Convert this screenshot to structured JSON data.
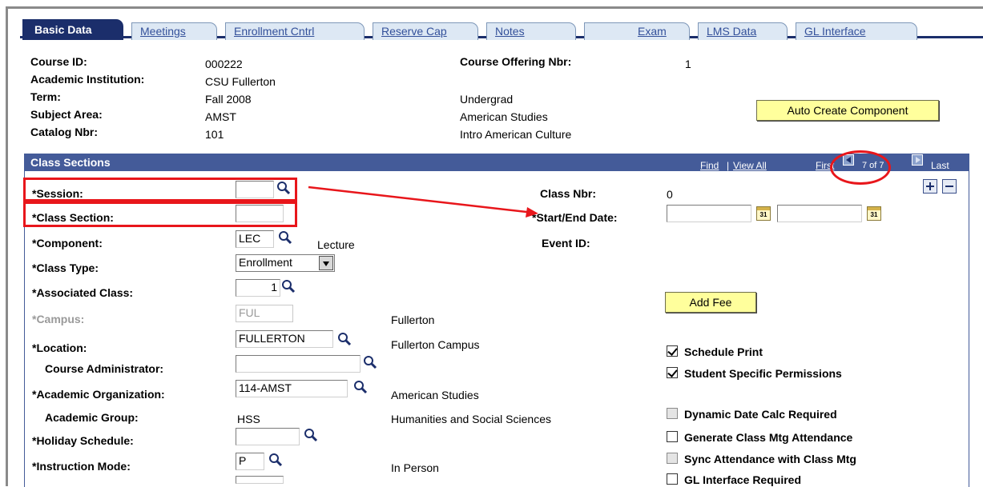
{
  "tabs": [
    {
      "label": "Basic Data",
      "active": true
    },
    {
      "label": "Meetings"
    },
    {
      "label": "Enrollment Cntrl"
    },
    {
      "label": "Reserve Cap"
    },
    {
      "label": "Notes"
    },
    {
      "label": "Exam"
    },
    {
      "label": "LMS Data"
    },
    {
      "label": "GL Interface"
    }
  ],
  "header": {
    "course_id_label": "Course ID:",
    "course_id": "000222",
    "offering_label": "Course Offering Nbr:",
    "offering": "1",
    "institution_label": "Academic Institution:",
    "institution": "CSU Fullerton",
    "term_label": "Term:",
    "term": "Fall 2008",
    "career": "Undergrad",
    "subject_label": "Subject Area:",
    "subject": "AMST",
    "subject_desc": "American Studies",
    "catalog_label": "Catalog Nbr:",
    "catalog": "101",
    "catalog_desc": "Intro American Culture",
    "auto_create_label": "Auto Create Component"
  },
  "section": {
    "title": "Class Sections",
    "find": "Find",
    "view_all": "View All",
    "first": "First",
    "count": "7 of 7",
    "last": "Last"
  },
  "form": {
    "session_label": "*Session:",
    "session_value": "",
    "class_section_label": "*Class Section:",
    "class_section_value": "",
    "component_label": "*Component:",
    "component_value": "LEC",
    "component_desc": "Lecture",
    "class_type_label": "*Class Type:",
    "class_type_value": "Enrollment",
    "assoc_class_label": "*Associated Class:",
    "assoc_class_value": "1",
    "campus_label": "*Campus:",
    "campus_value": "FUL",
    "campus_desc": "Fullerton",
    "location_label": "*Location:",
    "location_value": "FULLERTON",
    "location_desc": "Fullerton Campus",
    "course_admin_label": "Course Administrator:",
    "course_admin_value": "",
    "acad_org_label": "*Academic Organization:",
    "acad_org_value": "114-AMST",
    "acad_org_desc": "American Studies",
    "acad_group_label": "Academic Group:",
    "acad_group_value": "HSS",
    "acad_group_desc": "Humanities and Social Sciences",
    "holiday_label": "*Holiday Schedule:",
    "holiday_value": "",
    "instruction_label": "*Instruction Mode:",
    "instruction_value": "P",
    "instruction_desc": "In Person",
    "class_nbr_label": "Class Nbr:",
    "class_nbr_value": "0",
    "start_end_label": "*Start/End Date:",
    "start_date": "",
    "end_date": "",
    "event_id_label": "Event ID:",
    "add_fee_label": "Add Fee",
    "cal_text": "31"
  },
  "checkboxes": [
    {
      "label": "Schedule Print",
      "checked": true,
      "disabled": false
    },
    {
      "label": "Student Specific Permissions",
      "checked": true,
      "disabled": false
    },
    {
      "label": "Dynamic Date Calc Required",
      "checked": false,
      "disabled": true
    },
    {
      "label": "Generate Class Mtg Attendance",
      "checked": false,
      "disabled": false
    },
    {
      "label": "Sync Attendance with Class Mtg",
      "checked": false,
      "disabled": true
    },
    {
      "label": "GL Interface Required",
      "checked": false,
      "disabled": false
    }
  ],
  "colors": {
    "tab_active": "#1b2e6b",
    "section_bar": "#445b99",
    "button_bg": "#ffff9c",
    "annotation_red": "#e8161b"
  }
}
